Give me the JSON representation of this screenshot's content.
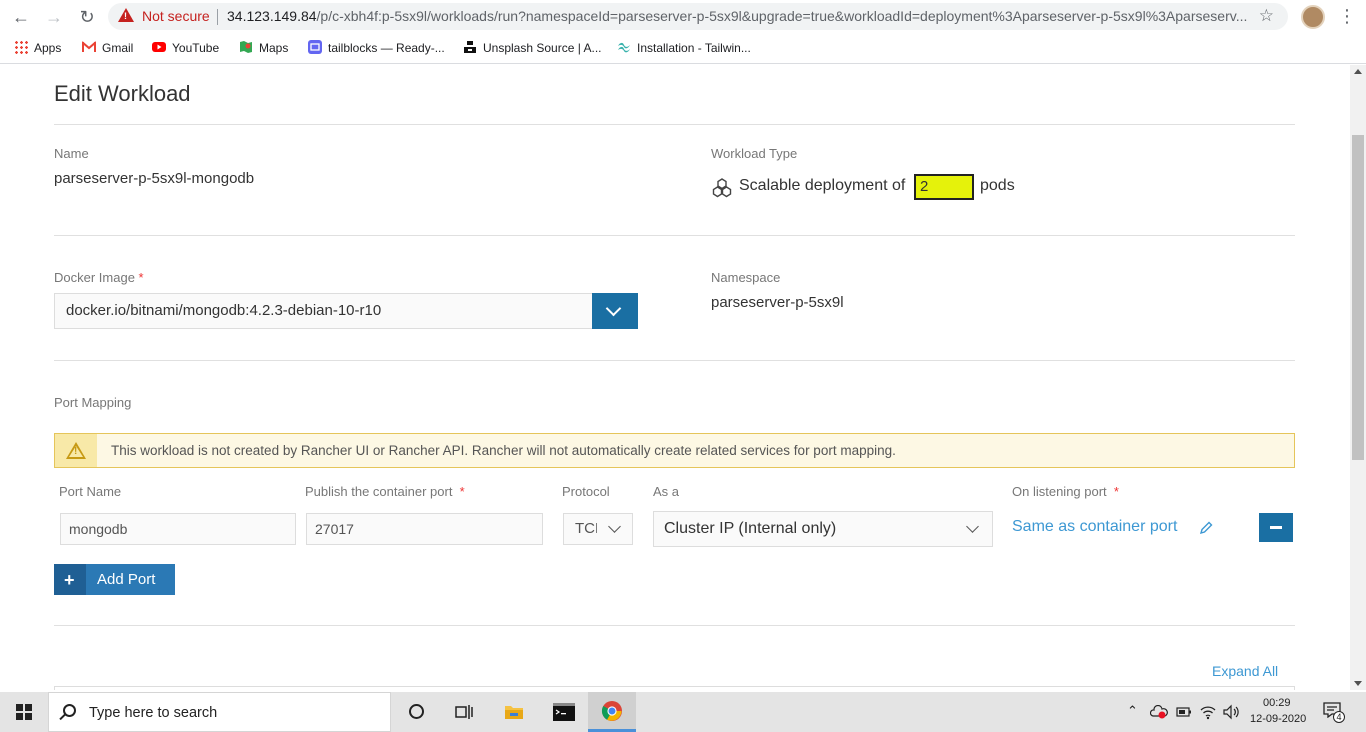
{
  "browser": {
    "security_label": "Not secure",
    "url_host": "34.123.149.84",
    "url_path": "/p/c-xbh4f:p-5sx9l/workloads/run?namespaceId=parseserver-p-5sx9l&upgrade=true&workloadId=deployment%3Aparseserver-p-5sx9l%3Aparseserv..."
  },
  "bookmarks": [
    {
      "label": "Apps",
      "icon": "apps-grid-icon"
    },
    {
      "label": "Gmail",
      "icon": "gmail-icon"
    },
    {
      "label": "YouTube",
      "icon": "youtube-icon"
    },
    {
      "label": "Maps",
      "icon": "maps-icon"
    },
    {
      "label": "tailblocks — Ready-...",
      "icon": "tailblocks-icon"
    },
    {
      "label": "Unsplash Source | A...",
      "icon": "unsplash-icon"
    },
    {
      "label": "Installation - Tailwin...",
      "icon": "tailwind-icon"
    }
  ],
  "page": {
    "title": "Edit Workload",
    "name_label": "Name",
    "name_value": "parseserver-p-5sx9l-mongodb",
    "workload_type_label": "Workload Type",
    "workload_type_prefix": "Scalable deployment of",
    "scale_value": "2",
    "workload_type_suffix": "pods",
    "docker_image_label": "Docker Image",
    "required_mark": "*",
    "docker_image_value": "docker.io/bitnami/mongodb:4.2.3-debian-10-r10",
    "namespace_label": "Namespace",
    "namespace_value": "parseserver-p-5sx9l",
    "port_mapping_label": "Port Mapping",
    "warning_text": "This workload is not created by Rancher UI or Rancher API. Rancher will not automatically create related services for port mapping.",
    "columns": {
      "port_name": "Port Name",
      "publish_port": "Publish the container port",
      "protocol": "Protocol",
      "as_a": "As a",
      "listening_port": "On listening port"
    },
    "port_row": {
      "port_name": "mongodb",
      "publish_port": "27017",
      "protocol": "TCP",
      "as_a": "Cluster IP (Internal only)",
      "listening_port": "Same as container port"
    },
    "add_port_label": "Add Port",
    "expand_all_label": "Expand All"
  },
  "taskbar": {
    "search_placeholder": "Type here to search",
    "time": "00:29",
    "date": "12-09-2020",
    "notification_count": "4"
  },
  "colors": {
    "accent": "#1a6fa3",
    "link": "#3d98d3",
    "highlight": "#e5f20b",
    "warning_bg": "#fdf8e4",
    "not_secure": "#c5221f"
  }
}
